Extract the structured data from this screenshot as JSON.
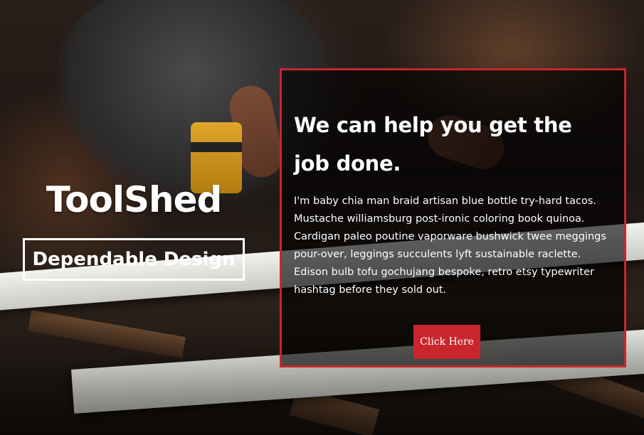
{
  "brand": {
    "title": "ToolShed",
    "tagline": "Dependable Design"
  },
  "cta": {
    "heading": "We can help you get the job done.",
    "body": "I'm baby chia man braid artisan blue bottle try-hard tacos. Mustache williamsburg post-ironic coloring book quinoa. Cardigan paleo poutine vaporware bushwick twee meggings pour-over, leggings succulents lyft sustainable raclette. Edison bulb tofu gochujang bespoke, retro etsy typewriter hashtag before they sold out.",
    "button_label": "Click Here"
  },
  "colors": {
    "accent": "#c8262c",
    "text": "#ffffff",
    "panel_overlay": "rgba(0,0,0,0.62)"
  }
}
